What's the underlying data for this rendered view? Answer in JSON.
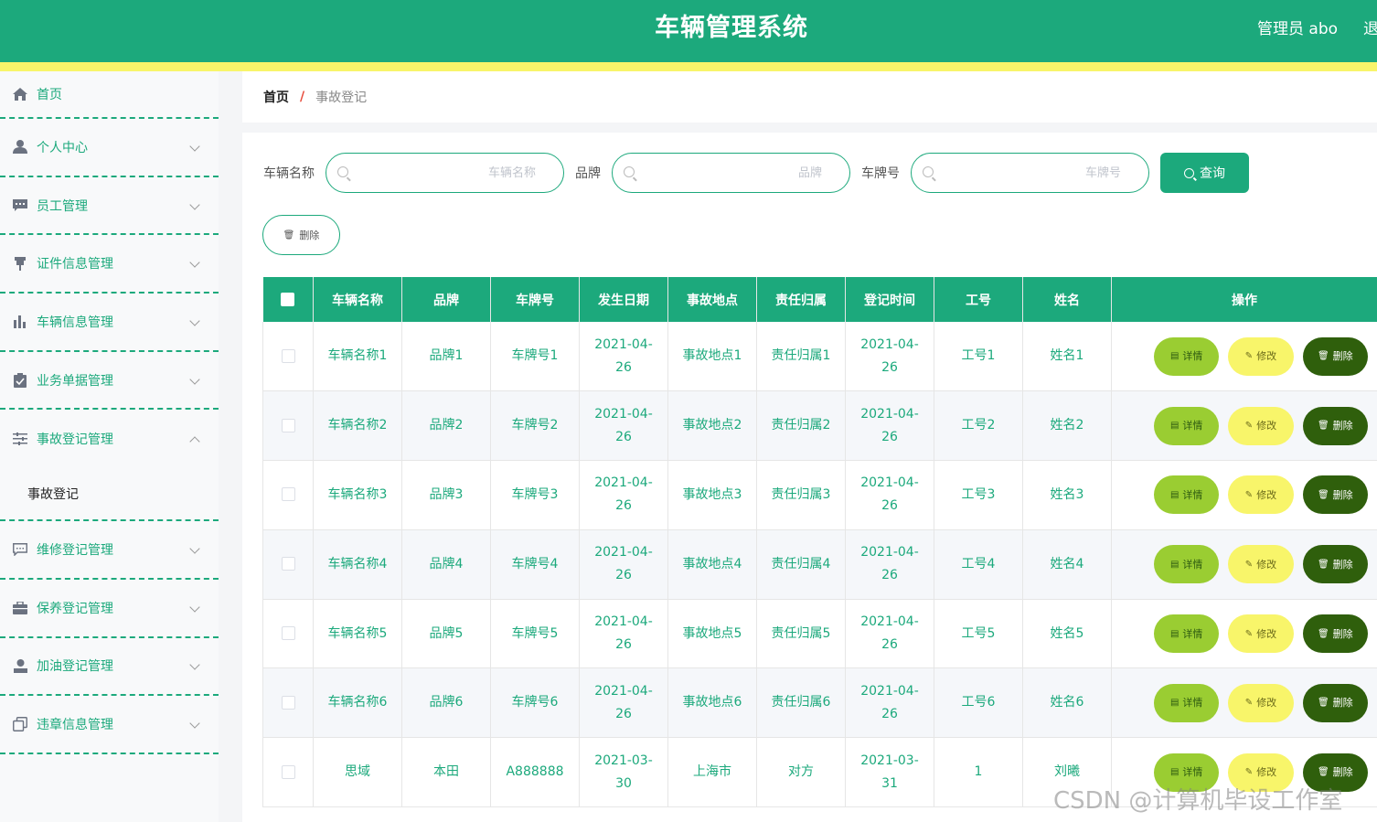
{
  "header": {
    "title": "车辆管理系统",
    "user": "管理员 abo",
    "logout": "退出"
  },
  "sidebar": {
    "items": [
      {
        "label": "首页",
        "icon": "home-icon"
      },
      {
        "label": "个人中心",
        "icon": "person-icon"
      },
      {
        "label": "员工管理",
        "icon": "chat-icon"
      },
      {
        "label": "证件信息管理",
        "icon": "pin-icon"
      },
      {
        "label": "车辆信息管理",
        "icon": "bar-chart-icon"
      },
      {
        "label": "业务单据管理",
        "icon": "clipboard-icon"
      },
      {
        "label": "事故登记管理",
        "icon": "sliders-icon",
        "sub": "事故登记"
      },
      {
        "label": "维修登记管理",
        "icon": "message-icon"
      },
      {
        "label": "保养登记管理",
        "icon": "briefcase-icon"
      },
      {
        "label": "加油登记管理",
        "icon": "user-icon"
      },
      {
        "label": "违章信息管理",
        "icon": "copy-icon"
      }
    ]
  },
  "breadcrumb": {
    "home": "首页",
    "separator": "/",
    "current": "事故登记"
  },
  "search": {
    "label1": "车辆名称",
    "placeholder1": "车辆名称",
    "label2": "品牌",
    "placeholder2": "品牌",
    "label3": "车牌号",
    "placeholder3": "车牌号",
    "query": "查询"
  },
  "toolbar": {
    "delete": "删除"
  },
  "table": {
    "headers": [
      "车辆名称",
      "品牌",
      "车牌号",
      "发生日期",
      "事故地点",
      "责任归属",
      "登记时间",
      "工号",
      "姓名",
      "操作"
    ],
    "rows": [
      {
        "name": "车辆名称1",
        "brand": "品牌1",
        "plate": "车牌号1",
        "date_a": "2021-04-",
        "date_b": "26",
        "place": "事故地点1",
        "resp": "责任归属1",
        "reg_a": "2021-04-",
        "reg_b": "26",
        "no": "工号1",
        "person": "姓名1"
      },
      {
        "name": "车辆名称2",
        "brand": "品牌2",
        "plate": "车牌号2",
        "date_a": "2021-04-",
        "date_b": "26",
        "place": "事故地点2",
        "resp": "责任归属2",
        "reg_a": "2021-04-",
        "reg_b": "26",
        "no": "工号2",
        "person": "姓名2"
      },
      {
        "name": "车辆名称3",
        "brand": "品牌3",
        "plate": "车牌号3",
        "date_a": "2021-04-",
        "date_b": "26",
        "place": "事故地点3",
        "resp": "责任归属3",
        "reg_a": "2021-04-",
        "reg_b": "26",
        "no": "工号3",
        "person": "姓名3"
      },
      {
        "name": "车辆名称4",
        "brand": "品牌4",
        "plate": "车牌号4",
        "date_a": "2021-04-",
        "date_b": "26",
        "place": "事故地点4",
        "resp": "责任归属4",
        "reg_a": "2021-04-",
        "reg_b": "26",
        "no": "工号4",
        "person": "姓名4"
      },
      {
        "name": "车辆名称5",
        "brand": "品牌5",
        "plate": "车牌号5",
        "date_a": "2021-04-",
        "date_b": "26",
        "place": "事故地点5",
        "resp": "责任归属5",
        "reg_a": "2021-04-",
        "reg_b": "26",
        "no": "工号5",
        "person": "姓名5"
      },
      {
        "name": "车辆名称6",
        "brand": "品牌6",
        "plate": "车牌号6",
        "date_a": "2021-04-",
        "date_b": "26",
        "place": "事故地点6",
        "resp": "责任归属6",
        "reg_a": "2021-04-",
        "reg_b": "26",
        "no": "工号6",
        "person": "姓名6"
      },
      {
        "name": "思域",
        "brand": "本田",
        "plate": "A888888",
        "date_a": "2021-03-",
        "date_b": "30",
        "place": "上海市",
        "resp": "对方",
        "reg_a": "2021-03-",
        "reg_b": "31",
        "no": "1",
        "person": "刘曦"
      }
    ],
    "actions": {
      "detail": "详情",
      "edit": "修改",
      "delete": "删除"
    }
  },
  "watermark": "CSDN @计算机毕设工作室",
  "colors": {
    "primary": "#1ca97c",
    "accent_yellow": "#f8f56a",
    "detail": "#9acd32",
    "delete": "#2f5f0c"
  }
}
